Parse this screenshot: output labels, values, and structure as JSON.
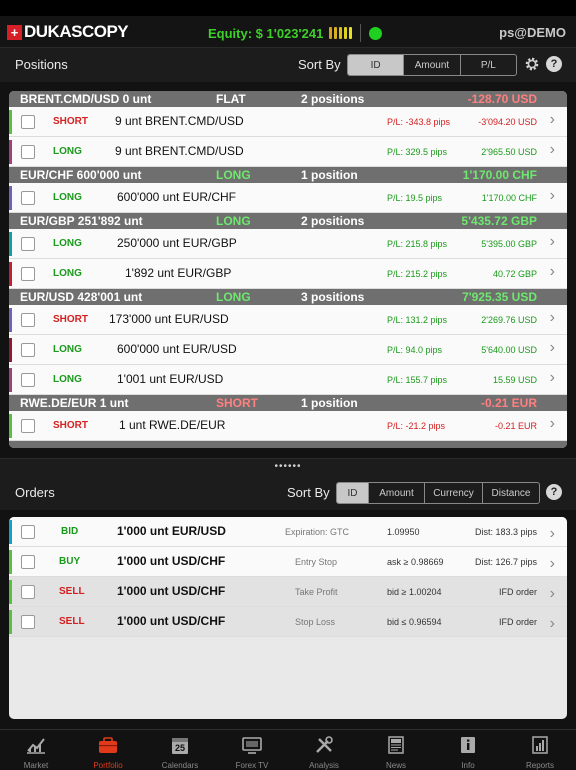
{
  "header": {
    "logo_text": "DUKASCOPY",
    "equity": "Equity: $ 1'023'241",
    "account": "ps@DEMO",
    "meter_colors": [
      "#d8a020",
      "#d8b020",
      "#d8c020",
      "#e0d020",
      "#e8e020"
    ],
    "status_color": "#20d020"
  },
  "positions": {
    "title": "Positions",
    "sort_by": "Sort By",
    "sort_options": [
      "ID",
      "Amount",
      "P/L"
    ],
    "groups": [
      {
        "name": "BRENT.CMD/USD 0 unt",
        "dir": "FLAT",
        "count": "2 positions",
        "total": "-128.70 USD",
        "total_color": "#ff8080",
        "rows": [
          {
            "side": "SHORT",
            "inst": "9 unt BRENT.CMD/USD",
            "pl": "P/L: -343.8 pips",
            "amt": "-3'094.20 USD",
            "stripe": "#58c040"
          },
          {
            "side": "LONG",
            "inst": "9 unt BRENT.CMD/USD",
            "pl": "P/L: 329.5 pips",
            "amt": "2'965.50 USD",
            "stripe": "#a0407a"
          }
        ]
      },
      {
        "name": "EUR/CHF 600'000 unt",
        "dir": "LONG",
        "count": "1 position",
        "total": "1'170.00 CHF",
        "total_color": "#6ee86e",
        "rows": [
          {
            "side": "LONG",
            "inst": "600'000 unt EUR/CHF",
            "pl": "P/L: 19.5 pips",
            "amt": "1'170.00 CHF",
            "stripe": "#7060b8"
          }
        ]
      },
      {
        "name": "EUR/GBP 251'892 unt",
        "dir": "LONG",
        "count": "2 positions",
        "total": "5'435.72 GBP",
        "total_color": "#6ee86e",
        "rows": [
          {
            "side": "LONG",
            "inst": "250'000 unt EUR/GBP",
            "pl": "P/L: 215.8 pips",
            "amt": "5'395.00 GBP",
            "stripe": "#10a0a0"
          },
          {
            "side": "LONG",
            "inst": "1'892 unt EUR/GBP",
            "pl": "P/L: 215.2 pips",
            "amt": "40.72 GBP",
            "stripe": "#c02030"
          }
        ]
      },
      {
        "name": "EUR/USD 428'001 unt",
        "dir": "LONG",
        "count": "3 positions",
        "total": "7'925.35 USD",
        "total_color": "#6ee86e",
        "rows": [
          {
            "side": "SHORT",
            "inst": "173'000 unt EUR/USD",
            "pl": "P/L: 131.2 pips",
            "amt": "2'269.76 USD",
            "stripe": "#7060b8"
          },
          {
            "side": "LONG",
            "inst": "600'000 unt EUR/USD",
            "pl": "P/L: 94.0 pips",
            "amt": "5'640.00 USD",
            "stripe": "#901830"
          },
          {
            "side": "LONG",
            "inst": "1'001 unt EUR/USD",
            "pl": "P/L: 155.7 pips",
            "amt": "15.59 USD",
            "stripe": "#a0407a"
          }
        ]
      },
      {
        "name": "RWE.DE/EUR 1 unt",
        "dir": "SHORT",
        "count": "1 position",
        "total": "-0.21 EUR",
        "total_color": "#ff8080",
        "rows": [
          {
            "side": "SHORT",
            "inst": "1 unt RWE.DE/EUR",
            "pl": "P/L: -21.2 pips",
            "amt": "-0.21 EUR",
            "stripe": "#58c040"
          }
        ]
      }
    ]
  },
  "divider": "••••••",
  "orders": {
    "title": "Orders",
    "sort_by": "Sort By",
    "sort_options": [
      "ID",
      "Amount",
      "Currency",
      "Distance"
    ],
    "rows": [
      {
        "side": "BID",
        "inst": "1'000 unt EUR/USD",
        "type": "Expiration: GTC",
        "price": "1.09950",
        "dist": "Dist: 183.3 pips",
        "stripe": "#10a0d0"
      },
      {
        "side": "BUY",
        "inst": "1'000 unt USD/CHF",
        "type": "Entry Stop",
        "price": "ask ≥ 0.98669",
        "dist": "Dist: 126.7 pips",
        "stripe": "#58c040"
      },
      {
        "side": "SELL",
        "inst": "1'000 unt USD/CHF",
        "type": "Take Profit",
        "price": "bid ≥ 1.00204",
        "dist": "IFD order",
        "stripe": "#58c040"
      },
      {
        "side": "SELL",
        "inst": "1'000 unt USD/CHF",
        "type": "Stop Loss",
        "price": "bid ≤ 0.96594",
        "dist": "IFD order",
        "stripe": "#58c040"
      }
    ]
  },
  "tabs": [
    {
      "label": "Market",
      "icon": "chart-icon"
    },
    {
      "label": "Portfolio",
      "icon": "briefcase-icon",
      "active": true
    },
    {
      "label": "Calendars",
      "icon": "calendar-icon",
      "day": "25"
    },
    {
      "label": "Forex TV",
      "icon": "tv-icon"
    },
    {
      "label": "Analysis",
      "icon": "tools-icon"
    },
    {
      "label": "News",
      "icon": "news-icon"
    },
    {
      "label": "Info",
      "icon": "info-icon"
    },
    {
      "label": "Reports",
      "icon": "reports-icon"
    }
  ]
}
